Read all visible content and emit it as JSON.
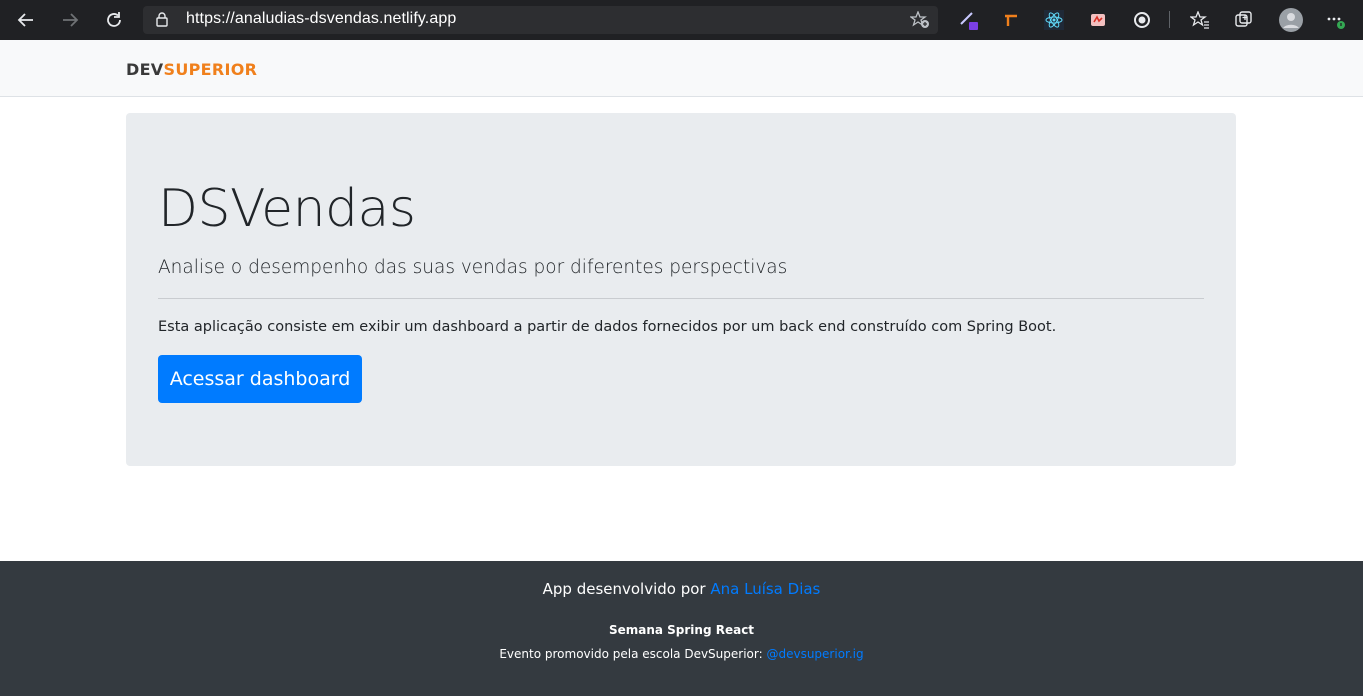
{
  "browser": {
    "url": "https://analudias-dsvendas.netlify.app",
    "icons": [
      "back-arrow-icon",
      "forward-arrow-icon",
      "reload-icon",
      "lock-icon",
      "add-favorite-icon",
      "extension-pen-icon",
      "extension-orange-icon",
      "extension-react-icon",
      "extension-red-icon",
      "extension-circle-icon",
      "favorites-icon",
      "collections-icon",
      "profile-icon",
      "more-menu-icon"
    ]
  },
  "navbar": {
    "logo_part1": "DEV",
    "logo_part2": "SUPERIOR"
  },
  "jumbotron": {
    "title": "DSVendas",
    "lead": "Analise o desempenho das suas vendas por diferentes perspectivas",
    "text": "Esta aplicação consiste em exibir um dashboard a partir de dados fornecidos por um back end construído com Spring Boot.",
    "button_label": "Acessar dashboard"
  },
  "footer": {
    "line1_prefix": "App desenvolvido por ",
    "author_link": "Ana Luísa Dias",
    "event_title": "Semana Spring React",
    "line3_prefix": "Evento promovido pela escola DevSuperior: ",
    "instagram_link": "@devsuperior.ig"
  },
  "colors": {
    "brand_orange": "#f0801c",
    "primary_blue": "#007bff",
    "footer_bg": "#343a40",
    "jumbotron_bg": "#e9ecef"
  }
}
